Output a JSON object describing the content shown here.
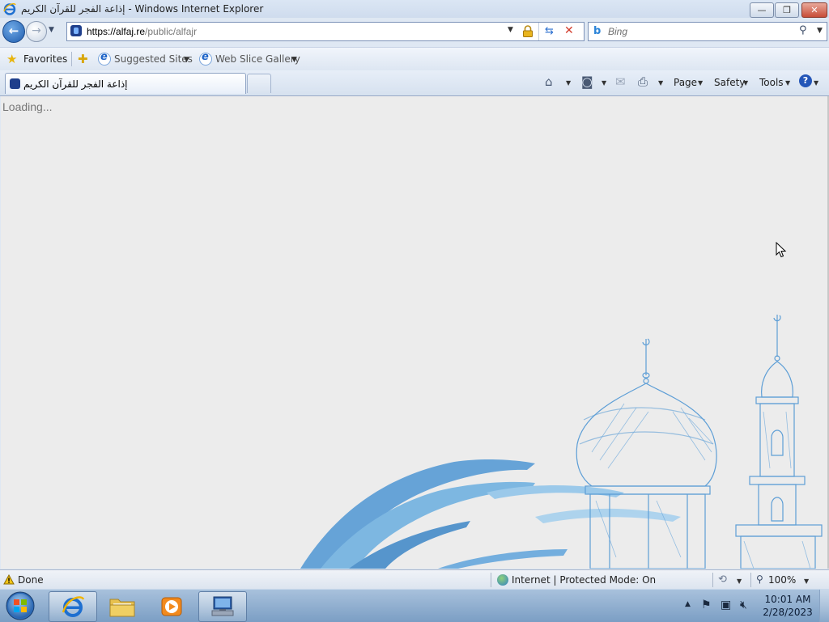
{
  "window": {
    "title": "إذاعة الفجر للقرآن الكريم - Windows Internet Explorer",
    "minimize_label": "—",
    "maximize_label": "❐",
    "close_label": "✕"
  },
  "nav": {
    "address_host": "https://alfaj.re",
    "address_path": "/public/alfajr",
    "search_placeholder": "Bing"
  },
  "favorites_bar": {
    "favorites_label": "Favorites",
    "suggested_sites_label": "Suggested Sites",
    "web_slice_label": "Web Slice Gallery"
  },
  "tab": {
    "label": "إذاعة الفجر للقرآن الكريم"
  },
  "command_bar": {
    "page_label": "Page",
    "safety_label": "Safety",
    "tools_label": "Tools"
  },
  "content": {
    "loading_text": "Loading..."
  },
  "status_bar": {
    "status_text": "Done",
    "zone_text": "Internet | Protected Mode: On",
    "zoom_text": "100%"
  },
  "taskbar": {
    "time": "10:01 AM",
    "date": "2/28/2023"
  },
  "colors": {
    "accent": "#2b6fcf",
    "content_bg": "#ececec",
    "mosque_sketch": "#5d9ed6"
  },
  "icons": {
    "back": "back-arrow-icon",
    "forward": "forward-arrow-icon",
    "lock": "lock-icon",
    "refresh": "refresh-icon",
    "stop": "stop-icon",
    "search": "search-icon",
    "home": "home-icon",
    "feeds": "rss-icon",
    "mail": "mail-icon",
    "print": "print-icon",
    "help": "help-icon"
  }
}
